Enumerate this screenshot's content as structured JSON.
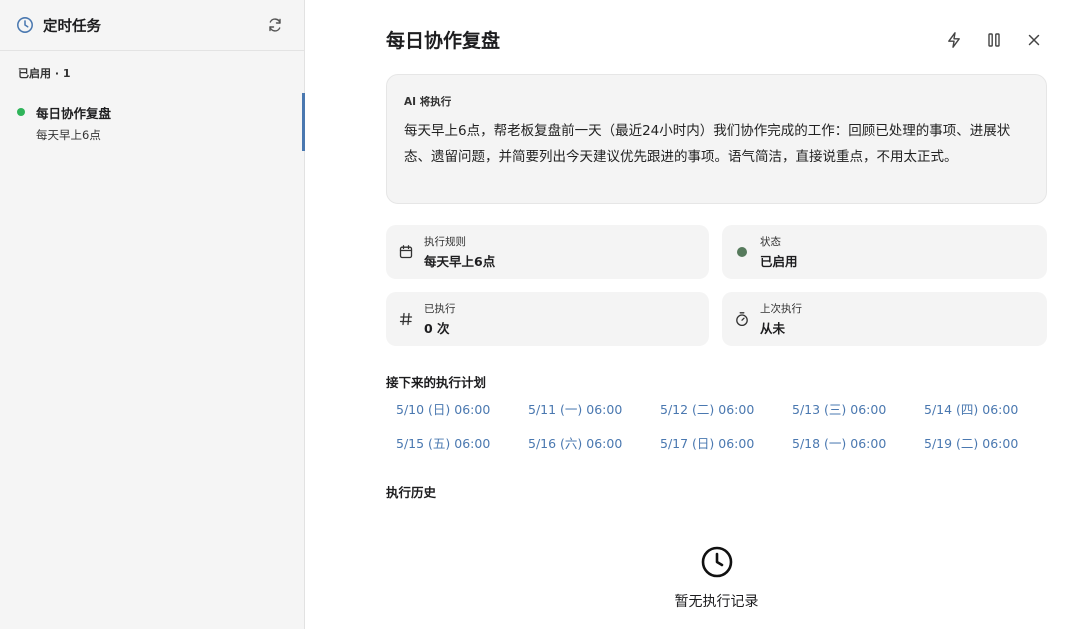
{
  "sidebar": {
    "title": "定时任务",
    "group_label": "已启用 · 1",
    "tasks": [
      {
        "name": "每日协作复盘",
        "schedule": "每天早上6点",
        "status_color": "#2fb45a"
      }
    ]
  },
  "detail": {
    "title": "每日协作复盘",
    "ai_label": "AI 将执行",
    "ai_text": "每天早上6点，帮老板复盘前一天（最近24小时内）我们协作完成的工作：回顾已处理的事项、进展状态、遗留问题，并简要列出今天建议优先跟进的事项。语气简洁，直接说重点，不用太正式。",
    "cards": {
      "rule": {
        "label": "执行规则",
        "value": "每天早上6点",
        "icon": "calendar-icon"
      },
      "status": {
        "label": "状态",
        "value": "已启用",
        "icon": "status-dot"
      },
      "count": {
        "label": "已执行",
        "value": "0 次",
        "icon": "hash-icon"
      },
      "last": {
        "label": "上次执行",
        "value": "从未",
        "icon": "stopwatch-icon"
      }
    },
    "plan_title": "接下来的执行计划",
    "plan": [
      "5/10 (日) 06:00",
      "5/11 (一) 06:00",
      "5/12 (二) 06:00",
      "5/13 (三) 06:00",
      "5/14 (四) 06:00",
      "5/15 (五) 06:00",
      "5/16 (六) 06:00",
      "5/17 (日) 06:00",
      "5/18 (一) 06:00",
      "5/19 (二) 06:00"
    ],
    "history_title": "执行历史",
    "history_empty": "暂无执行记录"
  },
  "colors": {
    "accent": "#4a78b0",
    "enabled_green": "#2fb45a",
    "status_green": "#567a5c"
  },
  "icons": [
    "clock-icon",
    "refresh-icon",
    "lightning-icon",
    "pause-icon",
    "close-icon",
    "calendar-icon",
    "hash-icon",
    "stopwatch-icon"
  ]
}
